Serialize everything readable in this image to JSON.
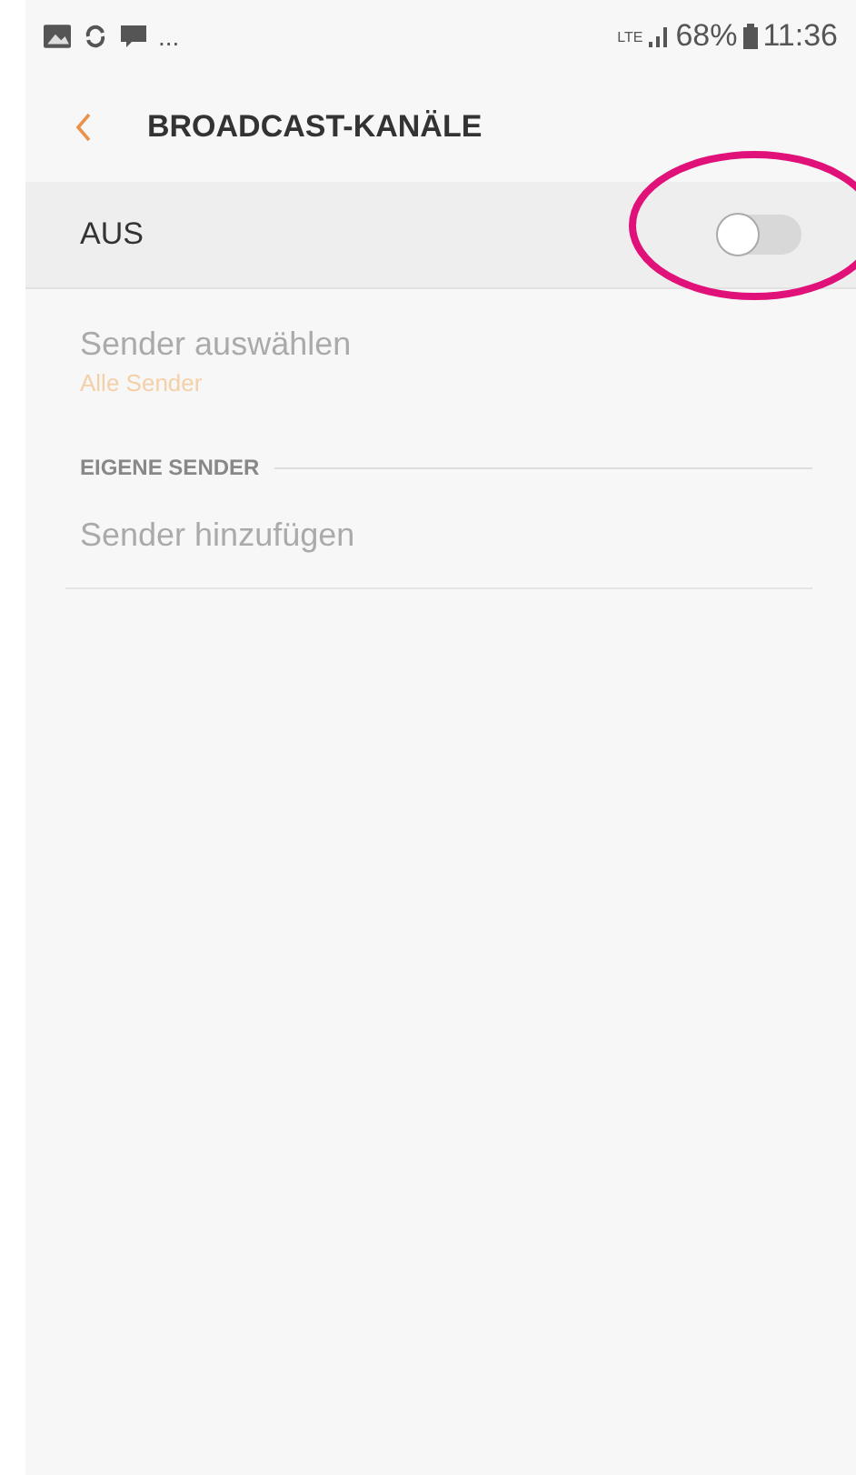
{
  "status_bar": {
    "notifications": "...",
    "network": "LTE",
    "battery": "68%",
    "time": "11:36"
  },
  "header": {
    "title": "BROADCAST-KANÄLE"
  },
  "master_switch": {
    "label": "AUS",
    "on": false
  },
  "items": [
    {
      "kind": "item",
      "title": "Sender auswählen",
      "subtitle": "Alle Sender",
      "disabled": true
    },
    {
      "kind": "section",
      "title": "EIGENE SENDER"
    },
    {
      "kind": "item",
      "title": "Sender hinzufügen",
      "disabled": true
    }
  ]
}
